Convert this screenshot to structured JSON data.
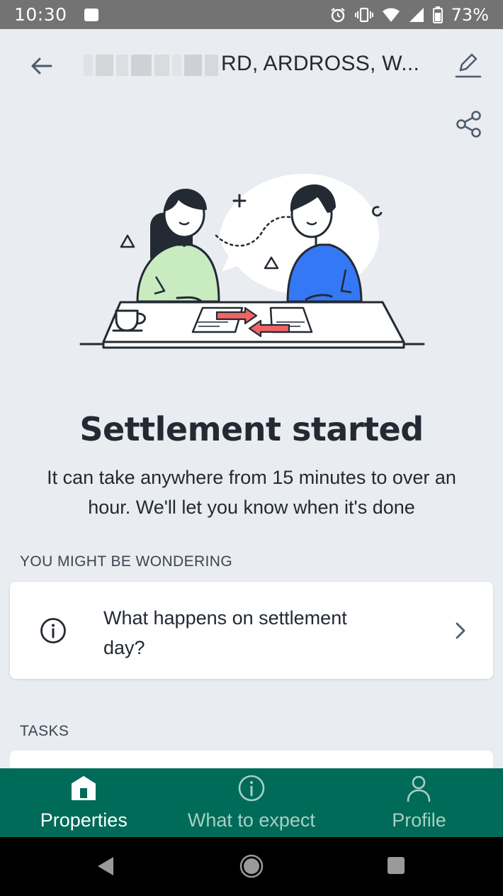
{
  "status_bar": {
    "time": "10:30",
    "battery_percent": "73%",
    "icons": [
      "image-icon",
      "alarm-icon",
      "vibrate-icon",
      "wifi-icon",
      "signal-icon",
      "battery-icon"
    ]
  },
  "header": {
    "address": "RD, ARDROSS, W...",
    "back_icon": "back-arrow-icon",
    "edit_icon": "edit-pencil-icon",
    "share_icon": "share-icon"
  },
  "main": {
    "headline": "Settlement started",
    "subtext": "It can take anywhere from 15 minutes to over an hour. We'll let you know when it's done"
  },
  "wondering": {
    "section_label": "YOU MIGHT BE WONDERING",
    "items": [
      {
        "text": "What happens on settlement day?",
        "icon": "info-icon"
      }
    ]
  },
  "tasks": {
    "section_label": "TASKS"
  },
  "bottom_nav": {
    "items": [
      {
        "label": "Properties",
        "icon": "home-icon",
        "active": true
      },
      {
        "label": "What to expect",
        "icon": "info-icon",
        "active": false
      },
      {
        "label": "Profile",
        "icon": "profile-icon",
        "active": false
      }
    ]
  },
  "colors": {
    "background": "#e9ecf0",
    "nav_green": "#006b58",
    "text_dark": "#232a33",
    "person_left_shirt": "#c8ebc0",
    "person_right_shirt": "#3578f5",
    "arrow_red": "#f06464"
  }
}
